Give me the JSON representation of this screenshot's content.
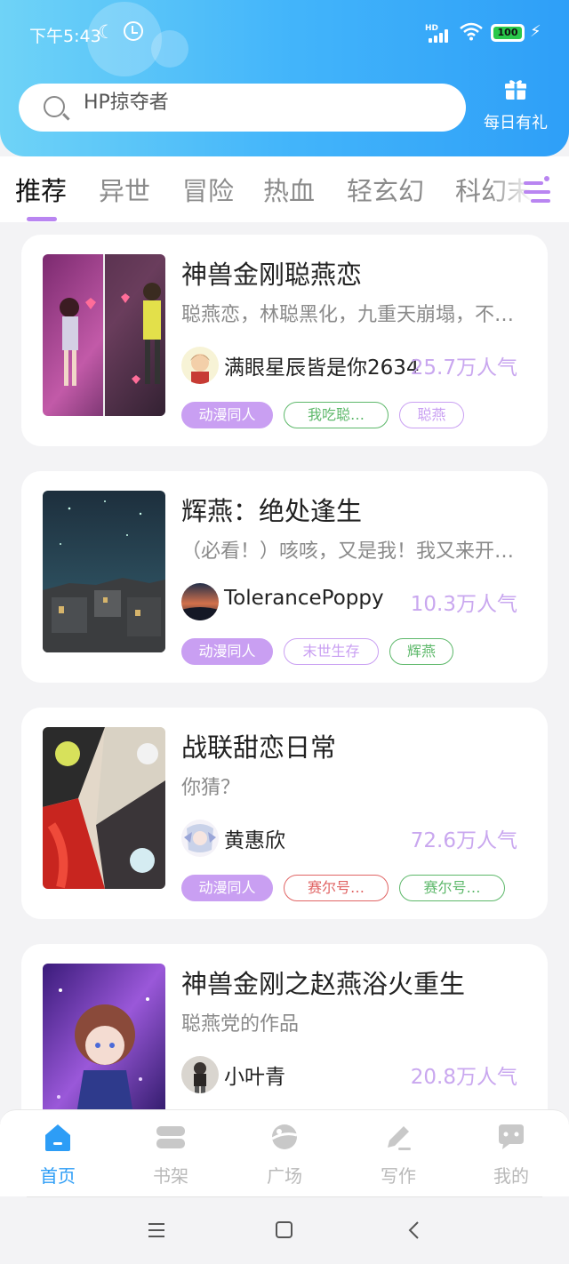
{
  "status_bar": {
    "time": "下午5:43",
    "hd": "HD",
    "battery": "100"
  },
  "search": {
    "placeholder": "HP掠夺者"
  },
  "gift": {
    "label": "每日有礼",
    "icon": "gift-icon"
  },
  "tabs": [
    {
      "label": "推荐",
      "active": true
    },
    {
      "label": "异世"
    },
    {
      "label": "冒险"
    },
    {
      "label": "热血"
    },
    {
      "label": "轻玄幻"
    },
    {
      "label": "科幻末"
    }
  ],
  "books": [
    {
      "title": "神兽金刚聪燕恋",
      "description": "聪燕恋，林聪黑化，九重天崩塌，不准抄袭",
      "author": "满眼星辰皆是你2634",
      "popularity": "25.7万人气",
      "tags": [
        {
          "label": "动漫同人",
          "style": "filled",
          "color": "#c99ff2"
        },
        {
          "label": "我吃聪…",
          "style": "outline",
          "color": "#5db86a"
        },
        {
          "label": "聪燕",
          "style": "outline",
          "color": "#c99ff2"
        }
      ]
    },
    {
      "title": "辉燕：绝处逢生",
      "description": "（必看！）咳咳，又是我！我又来开新书了",
      "author": "TolerancePoppy",
      "popularity": "10.3万人气",
      "tags": [
        {
          "label": "动漫同人",
          "style": "filled",
          "color": "#c99ff2"
        },
        {
          "label": "末世生存",
          "style": "outline",
          "color": "#c99ff2"
        },
        {
          "label": "辉燕",
          "style": "outline",
          "color": "#5db86a"
        }
      ]
    },
    {
      "title": "战联甜恋日常",
      "description": "你猜？",
      "author": "黄惠欣",
      "popularity": "72.6万人气",
      "tags": [
        {
          "label": "动漫同人",
          "style": "filled",
          "color": "#c99ff2"
        },
        {
          "label": "赛尔号…",
          "style": "outline",
          "color": "#e06464"
        },
        {
          "label": "赛尔号…",
          "style": "outline",
          "color": "#5db86a"
        }
      ]
    },
    {
      "title": "神兽金刚之赵燕浴火重生",
      "description": "聪燕党的作品",
      "author": "小叶青",
      "popularity": "20.8万人气",
      "tags": []
    }
  ],
  "bottom_nav": [
    {
      "label": "首页",
      "icon": "home-icon",
      "active": true
    },
    {
      "label": "书架",
      "icon": "bookshelf-icon"
    },
    {
      "label": "广场",
      "icon": "planet-icon"
    },
    {
      "label": "写作",
      "icon": "pen-icon"
    },
    {
      "label": "我的",
      "icon": "chat-bubble-icon"
    }
  ],
  "colors": {
    "accent": "#b985f1",
    "nav_active": "#2d9df6",
    "popularity": "#c9a7ef",
    "header_start": "#6fd3f7",
    "header_end": "#2e9ff8"
  }
}
